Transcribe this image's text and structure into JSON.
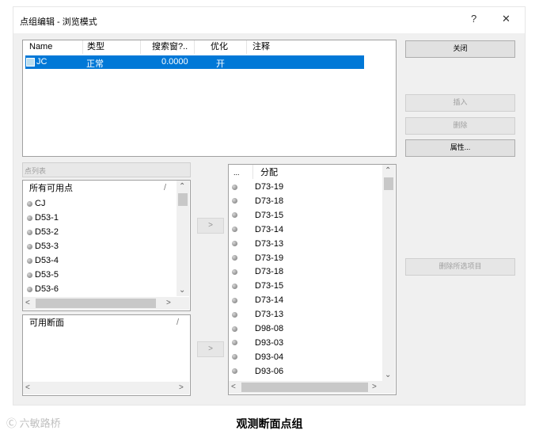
{
  "window": {
    "title": "点组编辑 - 浏览模式",
    "help": "?",
    "close": "✕"
  },
  "groups_table": {
    "headers": [
      "Name",
      "类型",
      "搜索窗?..",
      "优化",
      "注释"
    ],
    "row": {
      "name": "JC",
      "type": "正常",
      "search": "0.0000",
      "optimize": "开",
      "note": ""
    }
  },
  "buttons": {
    "close": "关闭",
    "insert": "插入",
    "delete": "删除",
    "properties": "属性...",
    "delete_selected": "删除所选项目",
    "add_point": ">",
    "add_section": ">"
  },
  "point_list_combo": "点列表",
  "available_points": {
    "header": "所有可用点",
    "items": [
      "CJ",
      "D53-1",
      "D53-2",
      "D53-3",
      "D53-4",
      "D53-5",
      "D53-6"
    ]
  },
  "available_sections": {
    "header": "可用断面"
  },
  "assigned": {
    "col1": "...",
    "col2": "分配",
    "items": [
      "D73-19",
      "D73-18",
      "D73-15",
      "D73-14",
      "D73-13",
      "D73-19",
      "D73-18",
      "D73-15",
      "D73-14",
      "D73-13",
      "D98-08",
      "D93-03",
      "D93-04",
      "D93-06"
    ]
  },
  "caption": "观测断面点组",
  "watermark": "Ⓒ 六敏路桥"
}
